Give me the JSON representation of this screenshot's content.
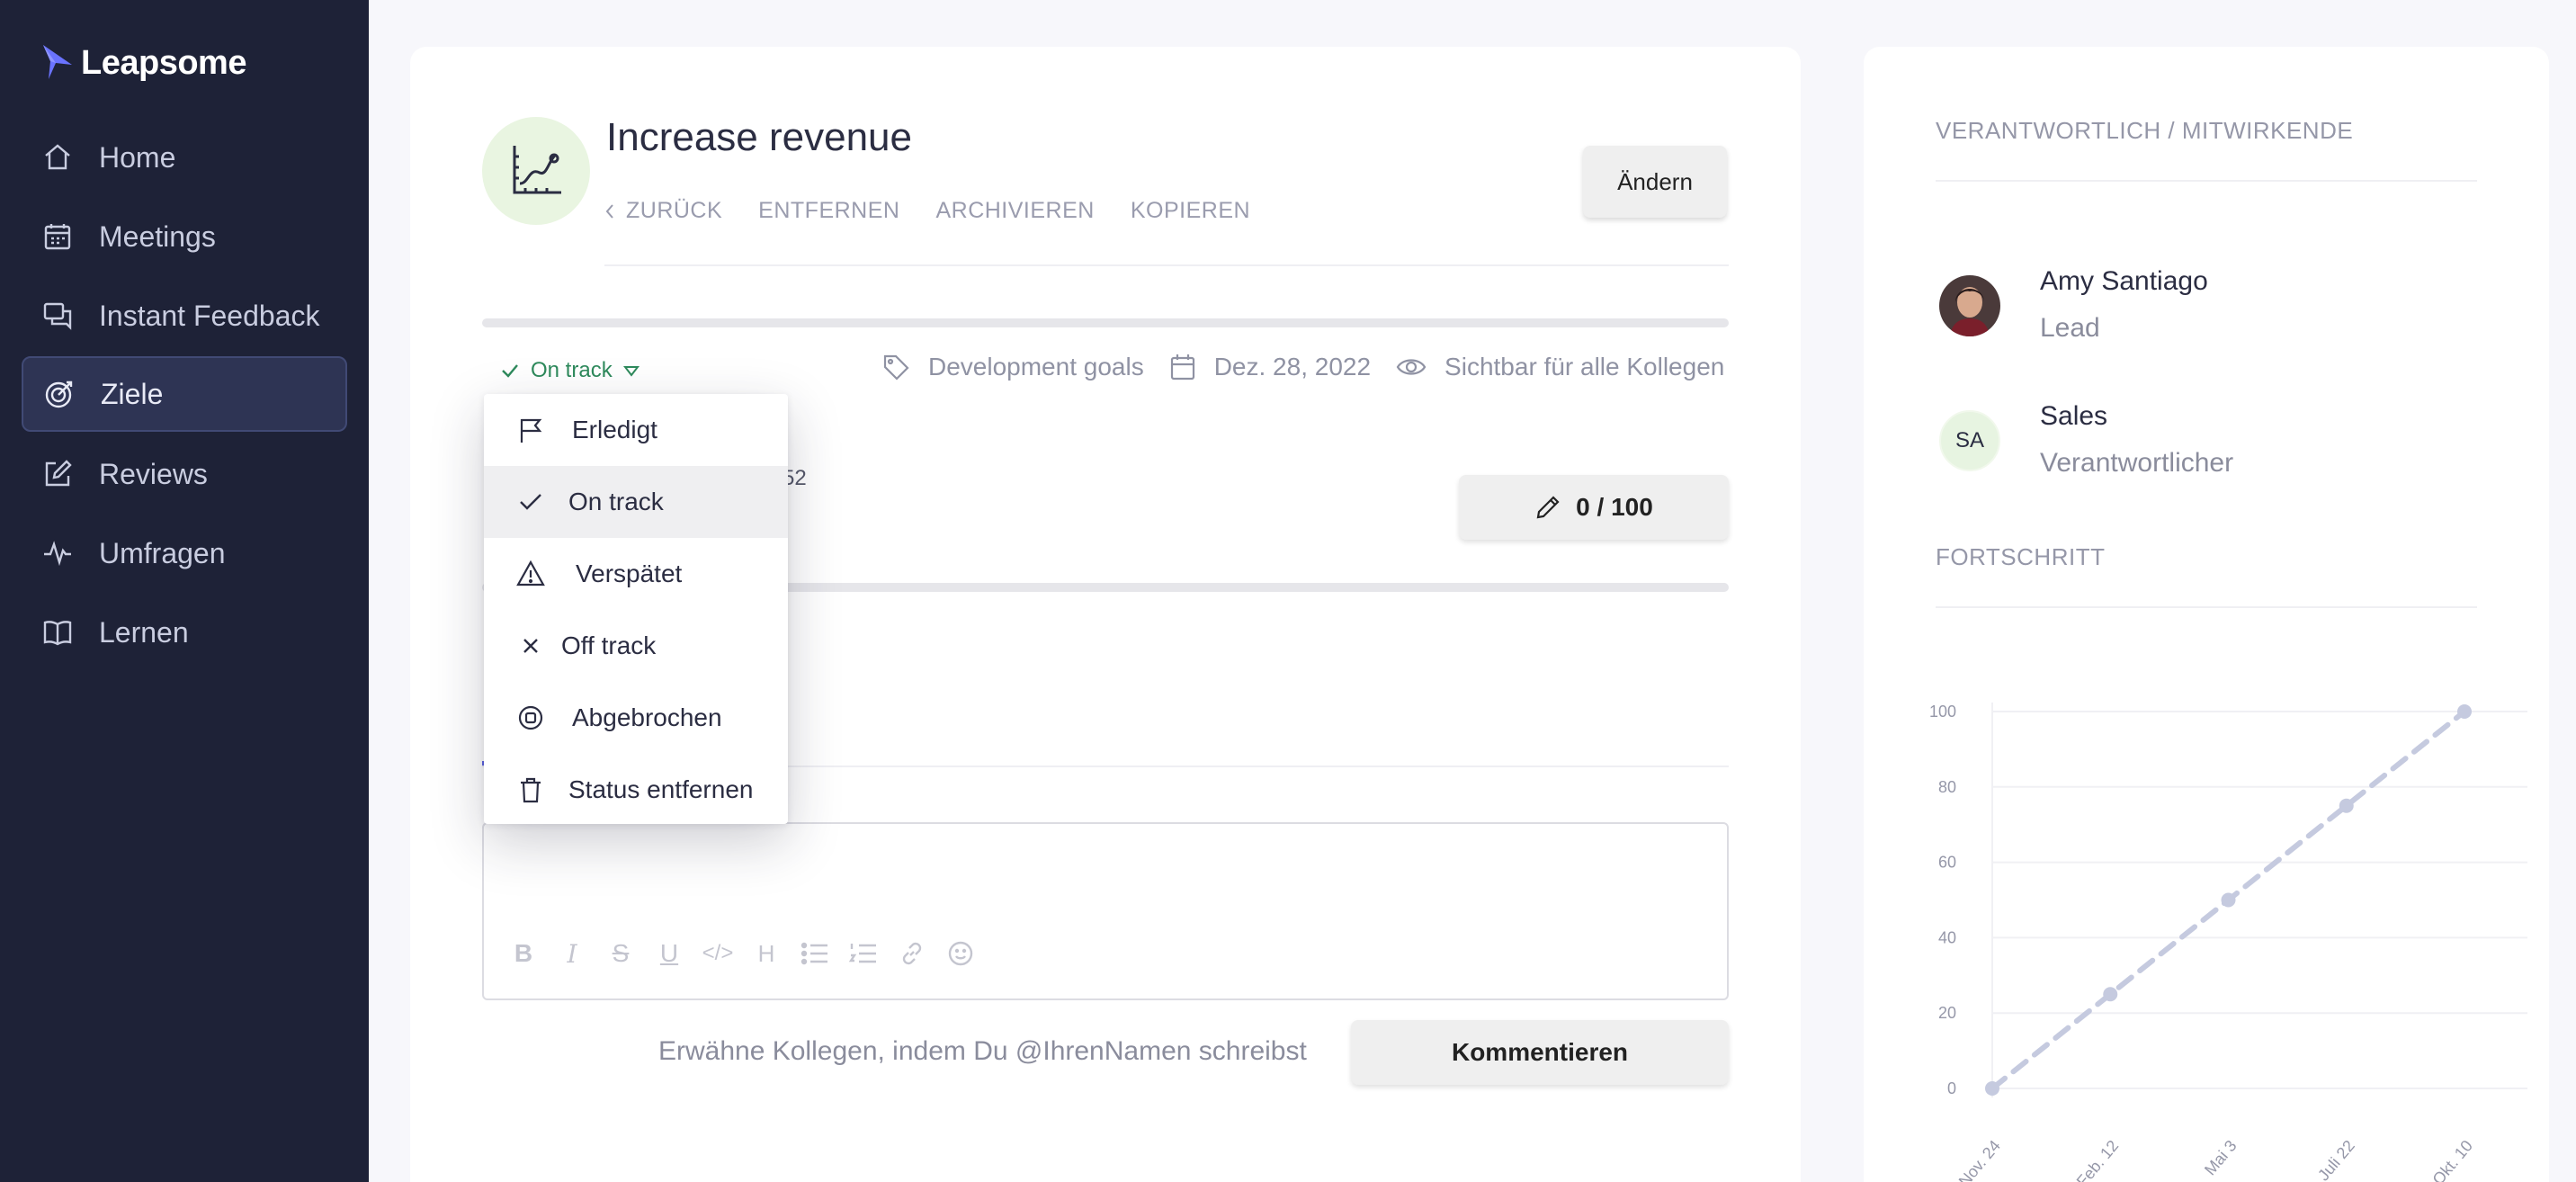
{
  "app": {
    "name": "Leapsome"
  },
  "sidebar": {
    "items": [
      {
        "label": "Home",
        "icon": "home-icon"
      },
      {
        "label": "Meetings",
        "icon": "calendar-icon"
      },
      {
        "label": "Instant Feedback",
        "icon": "feedback-icon"
      },
      {
        "label": "Ziele",
        "icon": "target-icon",
        "active": true
      },
      {
        "label": "Reviews",
        "icon": "edit-icon"
      },
      {
        "label": "Umfragen",
        "icon": "pulse-icon"
      },
      {
        "label": "Lernen",
        "icon": "book-icon"
      }
    ]
  },
  "goal": {
    "title": "Increase revenue",
    "links": {
      "back": "ZURÜCK",
      "remove": "ENTFERNEN",
      "archive": "ARCHIVIEREN",
      "copy": "KOPIEREN"
    },
    "change_button": "Ändern",
    "status": "On track",
    "tag": "Development goals",
    "date": "Dez. 28, 2022",
    "visibility": "Sichtbar für alle Kollegen",
    "partial_text": "52",
    "score": "0 / 100"
  },
  "status_menu": {
    "items": [
      {
        "label": "Erledigt",
        "icon": "flag-icon"
      },
      {
        "label": "On track",
        "icon": "check-icon",
        "selected": true
      },
      {
        "label": "Verspätet",
        "icon": "warning-icon"
      },
      {
        "label": "Off track",
        "icon": "x-icon"
      },
      {
        "label": "Abgebrochen",
        "icon": "stop-circle-icon"
      },
      {
        "label": "Status entfernen",
        "icon": "trash-icon"
      }
    ]
  },
  "comment": {
    "hint": "Erwähne Kollegen, indem Du @IhrenNamen schreibst",
    "submit": "Kommentieren",
    "toolbar": [
      "B",
      "I",
      "S",
      "U",
      "</>",
      "H",
      "bullet-list",
      "ordered-list",
      "link",
      "emoji"
    ]
  },
  "side": {
    "owners_title": "VERANTWORTLICH / MITWIRKENDE",
    "people": [
      {
        "name": "Amy Santiago",
        "role": "Lead",
        "avatar": "photo"
      },
      {
        "name": "Sales",
        "role": "Verantwortlicher",
        "avatar_initials": "SA"
      }
    ],
    "progress_title": "FORTSCHRITT"
  },
  "colors": {
    "sidebar_bg": "#1e2237",
    "status_green": "#2e8a5c",
    "chart_line": "#c5cadf"
  },
  "chart_data": {
    "type": "line",
    "x": [
      "Nov. 24",
      "Feb. 12",
      "Mai 3",
      "Juli 22",
      "Okt. 10"
    ],
    "y_ticks": [
      0,
      20,
      40,
      60,
      80,
      100
    ],
    "series": [
      {
        "values": [
          0,
          25,
          50,
          75,
          100
        ]
      }
    ],
    "ylim": [
      0,
      100
    ],
    "grid": true,
    "line_style": "dashed"
  }
}
